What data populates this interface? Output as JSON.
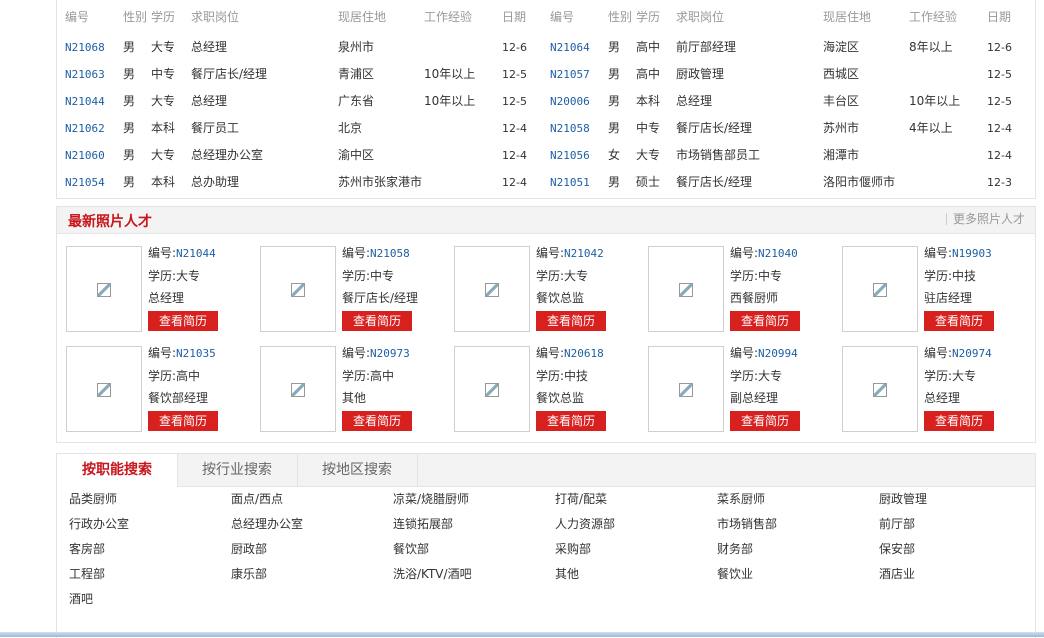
{
  "table": {
    "headers": [
      "编号",
      "性别",
      "学历",
      "求职岗位",
      "现居住地",
      "工作经验",
      "日期"
    ],
    "left_rows": [
      {
        "id": "N21068",
        "sex": "男",
        "edu": "大专",
        "job": "总经理",
        "loc": "泉州市",
        "exp": "",
        "date": "12-6"
      },
      {
        "id": "N21063",
        "sex": "男",
        "edu": "中专",
        "job": "餐厅店长/经理",
        "loc": "青浦区",
        "exp": "10年以上",
        "date": "12-5"
      },
      {
        "id": "N21044",
        "sex": "男",
        "edu": "大专",
        "job": "总经理",
        "loc": "广东省",
        "exp": "10年以上",
        "date": "12-5"
      },
      {
        "id": "N21062",
        "sex": "男",
        "edu": "本科",
        "job": "餐厅员工",
        "loc": "北京",
        "exp": "",
        "date": "12-4"
      },
      {
        "id": "N21060",
        "sex": "男",
        "edu": "大专",
        "job": "总经理办公室",
        "loc": "渝中区",
        "exp": "",
        "date": "12-4"
      },
      {
        "id": "N21054",
        "sex": "男",
        "edu": "本科",
        "job": "总办助理",
        "loc": "苏州市张家港市",
        "exp": "",
        "date": "12-4"
      }
    ],
    "right_rows": [
      {
        "id": "N21064",
        "sex": "男",
        "edu": "高中",
        "job": "前厅部经理",
        "loc": "海淀区",
        "exp": "8年以上",
        "date": "12-6"
      },
      {
        "id": "N21057",
        "sex": "男",
        "edu": "高中",
        "job": "厨政管理",
        "loc": "西城区",
        "exp": "",
        "date": "12-5"
      },
      {
        "id": "N20006",
        "sex": "男",
        "edu": "本科",
        "job": "总经理",
        "loc": "丰台区",
        "exp": "10年以上",
        "date": "12-5"
      },
      {
        "id": "N21058",
        "sex": "男",
        "edu": "中专",
        "job": "餐厅店长/经理",
        "loc": "苏州市",
        "exp": "4年以上",
        "date": "12-4"
      },
      {
        "id": "N21056",
        "sex": "女",
        "edu": "大专",
        "job": "市场销售部员工",
        "loc": "湘潭市",
        "exp": "",
        "date": "12-4"
      },
      {
        "id": "N21051",
        "sex": "男",
        "edu": "硕士",
        "job": "餐厅店长/经理",
        "loc": "洛阳市偃师市",
        "exp": "",
        "date": "12-3"
      }
    ]
  },
  "photos": {
    "title": "最新照片人才",
    "more": "更多照片人才",
    "num_label": "编号:",
    "edu_label": "学历:",
    "button": "查看简历",
    "items": [
      {
        "num": "N21044",
        "edu": "大专",
        "job": "总经理"
      },
      {
        "num": "N21058",
        "edu": "中专",
        "job": "餐厅店长/经理"
      },
      {
        "num": "N21042",
        "edu": "大专",
        "job": "餐饮总监"
      },
      {
        "num": "N21040",
        "edu": "中专",
        "job": "西餐厨师"
      },
      {
        "num": "N19903",
        "edu": "中技",
        "job": "驻店经理"
      },
      {
        "num": "N21035",
        "edu": "高中",
        "job": "餐饮部经理"
      },
      {
        "num": "N20973",
        "edu": "高中",
        "job": "其他"
      },
      {
        "num": "N20618",
        "edu": "中技",
        "job": "餐饮总监"
      },
      {
        "num": "N20994",
        "edu": "大专",
        "job": "副总经理"
      },
      {
        "num": "N20974",
        "edu": "大专",
        "job": "总经理"
      }
    ]
  },
  "search": {
    "tabs": [
      "按职能搜索",
      "按行业搜索",
      "按地区搜索"
    ],
    "categories": [
      "品类厨师",
      "面点/西点",
      "凉菜/烧腊厨师",
      "打荷/配菜",
      "菜系厨师",
      "厨政管理",
      "行政办公室",
      "总经理办公室",
      "连锁拓展部",
      "人力资源部",
      "市场销售部",
      "前厅部",
      "客房部",
      "厨政部",
      "餐饮部",
      "采购部",
      "财务部",
      "保安部",
      "工程部",
      "康乐部",
      "洗浴/KTV/酒吧",
      "其他",
      "餐饮业",
      "酒店业",
      "酒吧"
    ]
  },
  "colors": {
    "accent": "#c8161d",
    "link": "#1d5fa4",
    "button": "#d8201f"
  }
}
